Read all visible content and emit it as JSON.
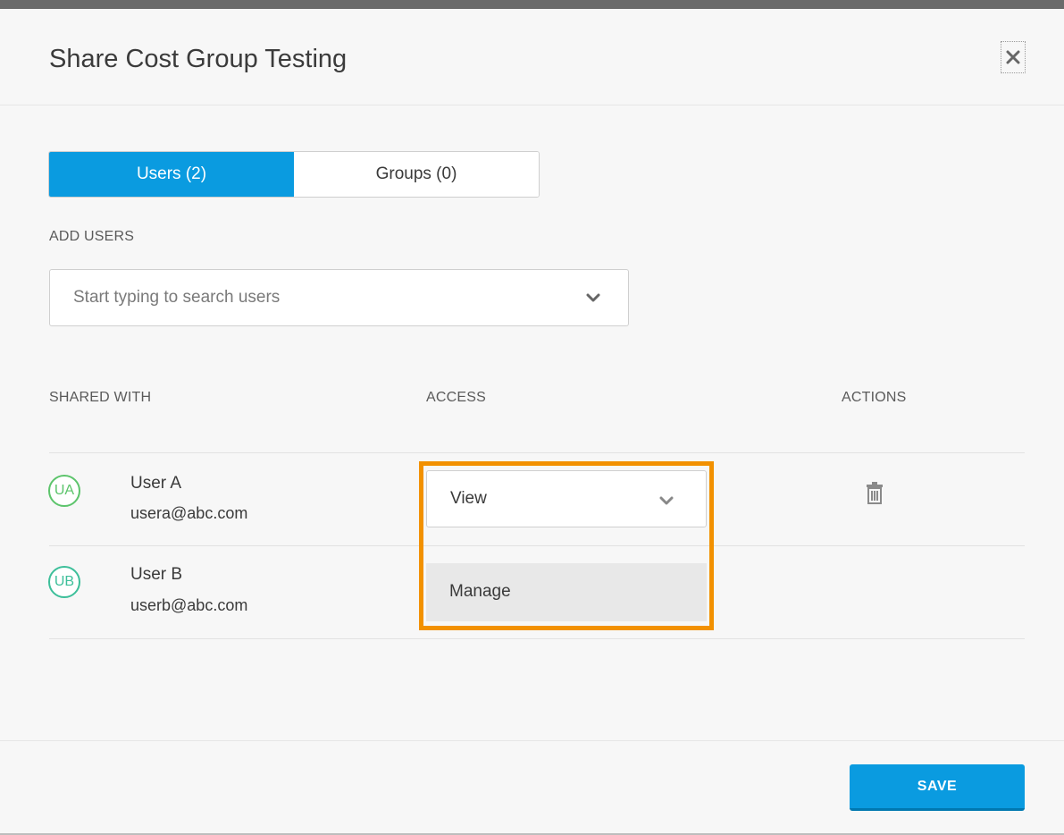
{
  "dialog": {
    "title": "Share Cost Group Testing",
    "close_icon": "close-icon"
  },
  "tabs": [
    {
      "label": "Users (2)",
      "active": true
    },
    {
      "label": "Groups (0)",
      "active": false
    }
  ],
  "add_users": {
    "label": "ADD USERS",
    "placeholder": "Start typing to search users"
  },
  "table": {
    "headers": {
      "shared_with": "SHARED WITH",
      "access": "ACCESS",
      "actions": "ACTIONS"
    },
    "rows": [
      {
        "initials": "UA",
        "name": "User A",
        "email": "usera@abc.com",
        "avatar_color": "#5cc46b"
      },
      {
        "initials": "UB",
        "name": "User B",
        "email": "userb@abc.com",
        "avatar_color": "#3dbf9a"
      }
    ]
  },
  "access_dropdown": {
    "selected": "View",
    "options": [
      "Manage"
    ],
    "highlight_color": "#f29100"
  },
  "footer": {
    "save_label": "SAVE"
  },
  "colors": {
    "primary": "#0a9be0",
    "highlight": "#f29100"
  }
}
